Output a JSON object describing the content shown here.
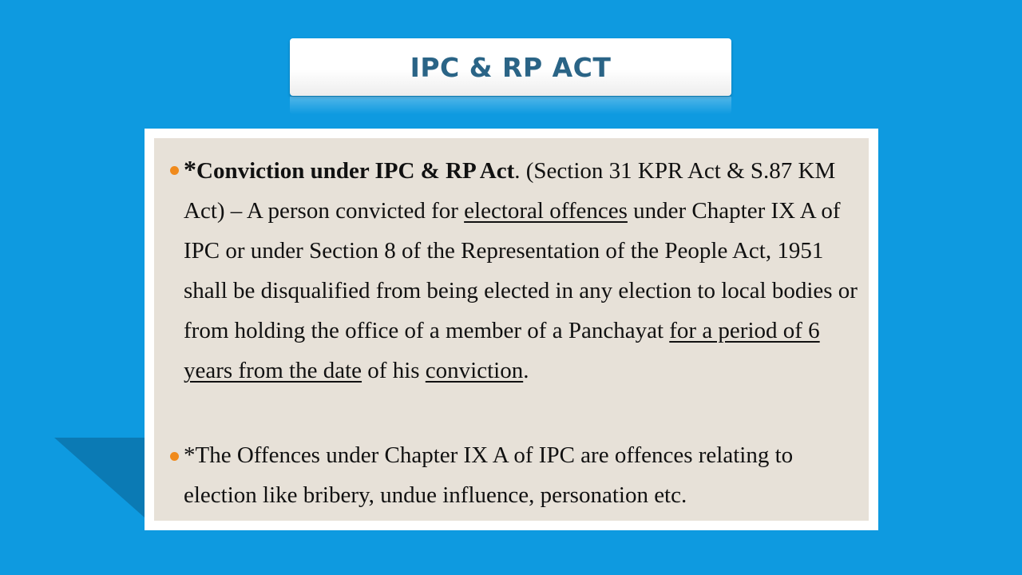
{
  "slide": {
    "title": "IPC & RP ACT"
  },
  "bullets": [
    {
      "star": "*",
      "bold_heading": "Conviction under IPC & RP Act",
      "after_heading": ". (Section 31 KPR Act & S.87 KM Act) – A person convicted for ",
      "underline_1": "electoral offences",
      "text_2": " under Chapter IX A of IPC or under Section 8 of the Representation of the People Act, 1951 shall be disqualified from being elected in any election to local bodies or from holding the office of a member of a Panchayat ",
      "underline_2": "for a period of 6 years from the date",
      "text_3": " of his ",
      "underline_3": "conviction",
      "text_4": "."
    },
    {
      "text": "*The Offences under Chapter IX A of IPC are offences relating to election like bribery, undue influence, personation etc."
    }
  ],
  "colors": {
    "background": "#0e9ae0",
    "title_text": "#2a6486",
    "content_bg": "#e7e1d8",
    "bullet_dot": "#f08a1c"
  }
}
